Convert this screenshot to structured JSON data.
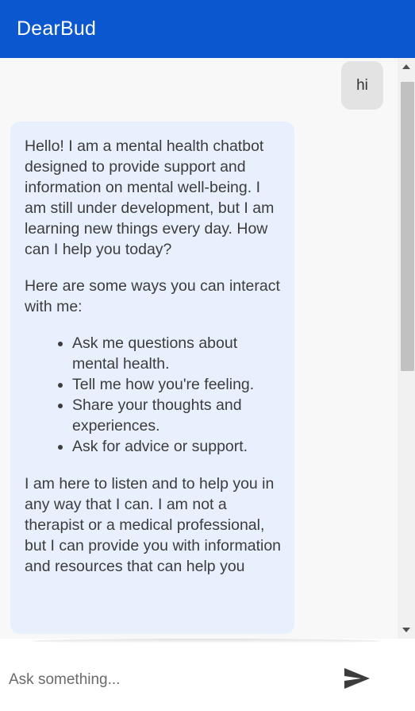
{
  "app": {
    "title": "DearBud",
    "accent_color": "#0b57d0"
  },
  "messages": {
    "user": {
      "text": "hi"
    },
    "bot": {
      "intro": "Hello! I am a mental health chatbot designed to provide support and information on mental well-being. I am still under development, but I am learning new things every day. How can I help you today?",
      "ways_heading": "Here are some ways you can interact with me:",
      "items": [
        "Ask me questions about mental health.",
        "Tell me how you're feeling.",
        "Share your thoughts and experiences.",
        "Ask for advice or support."
      ],
      "closing": "I am here to listen and to help you in any way that I can. I am not a therapist or a medical professional, but I can provide you with information and resources that can help you"
    }
  },
  "input": {
    "placeholder": "Ask something...",
    "value": "",
    "send_icon": "send-icon"
  }
}
